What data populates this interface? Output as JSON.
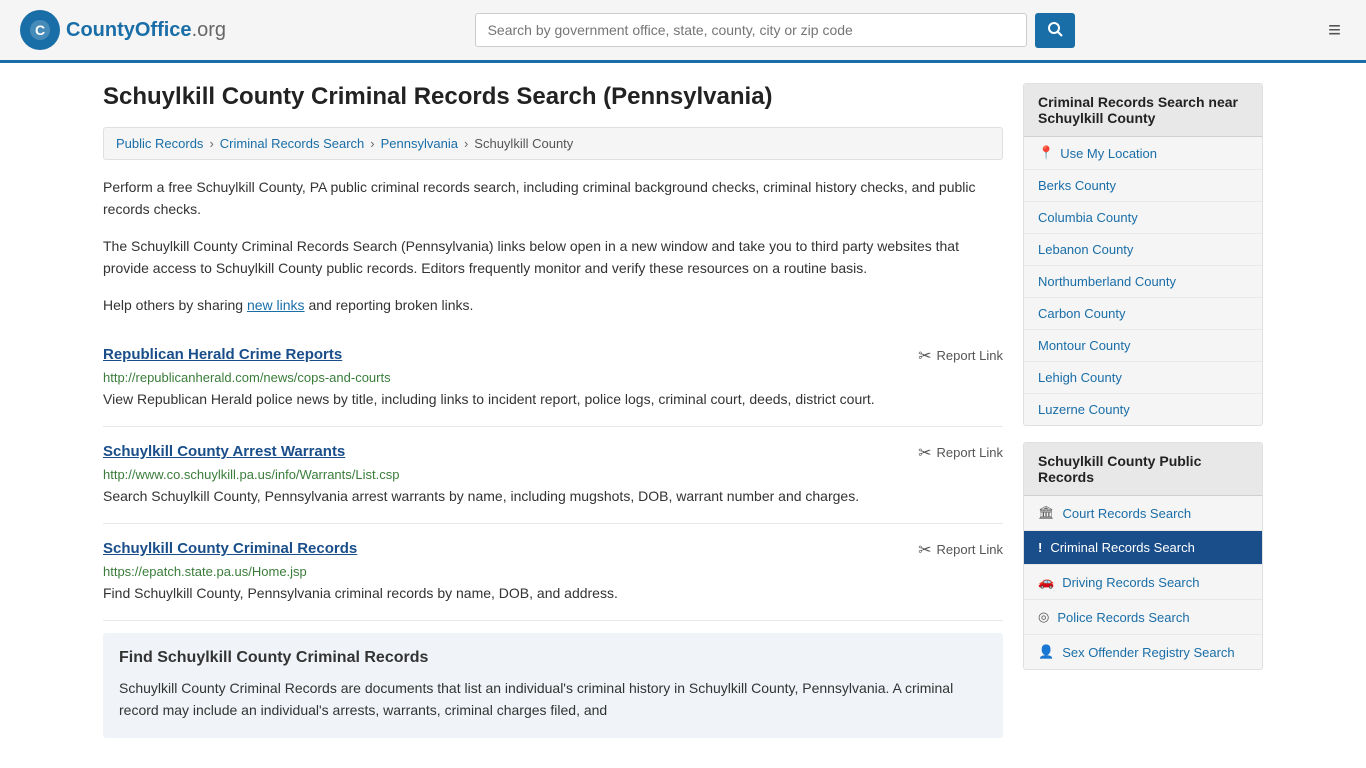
{
  "header": {
    "logo_text": "CountyOffice",
    "logo_tld": ".org",
    "search_placeholder": "Search by government office, state, county, city or zip code",
    "menu_icon": "≡"
  },
  "page": {
    "title": "Schuylkill County Criminal Records Search (Pennsylvania)",
    "breadcrumb": [
      {
        "label": "Public Records",
        "href": "#"
      },
      {
        "label": "Criminal Records Search",
        "href": "#"
      },
      {
        "label": "Pennsylvania",
        "href": "#"
      },
      {
        "label": "Schuylkill County",
        "href": "#"
      }
    ],
    "description1": "Perform a free Schuylkill County, PA public criminal records search, including criminal background checks, criminal history checks, and public records checks.",
    "description2": "The Schuylkill County Criminal Records Search (Pennsylvania) links below open in a new window and take you to third party websites that provide access to Schuylkill County public records. Editors frequently monitor and verify these resources on a routine basis.",
    "description3_prefix": "Help others by sharing ",
    "description3_link": "new links",
    "description3_suffix": " and reporting broken links.",
    "resources": [
      {
        "title": "Republican Herald Crime Reports",
        "url": "http://republicanherald.com/news/cops-and-courts",
        "desc": "View Republican Herald police news by title, including links to incident report, police logs, criminal court, deeds, district court.",
        "report_label": "Report Link"
      },
      {
        "title": "Schuylkill County Arrest Warrants",
        "url": "http://www.co.schuylkill.pa.us/info/Warrants/List.csp",
        "desc": "Search Schuylkill County, Pennsylvania arrest warrants by name, including mugshots, DOB, warrant number and charges.",
        "report_label": "Report Link"
      },
      {
        "title": "Schuylkill County Criminal Records",
        "url": "https://epatch.state.pa.us/Home.jsp",
        "desc": "Find Schuylkill County, Pennsylvania criminal records by name, DOB, and address.",
        "report_label": "Report Link"
      }
    ],
    "find_section": {
      "title": "Find Schuylkill County Criminal Records",
      "desc": "Schuylkill County Criminal Records are documents that list an individual's criminal history in Schuylkill County, Pennsylvania. A criminal record may include an individual's arrests, warrants, criminal charges filed, and"
    }
  },
  "sidebar": {
    "nearby_section": {
      "title": "Criminal Records Search near Schuylkill County",
      "use_location": "Use My Location",
      "counties": [
        "Berks County",
        "Columbia County",
        "Lebanon County",
        "Northumberland County",
        "Carbon County",
        "Montour County",
        "Lehigh County",
        "Luzerne County"
      ]
    },
    "public_records_section": {
      "title": "Schuylkill County Public Records",
      "items": [
        {
          "label": "Court Records Search",
          "icon": "🏛",
          "active": false
        },
        {
          "label": "Criminal Records Search",
          "icon": "!",
          "active": true
        },
        {
          "label": "Driving Records Search",
          "icon": "🚗",
          "active": false
        },
        {
          "label": "Police Records Search",
          "icon": "◎",
          "active": false
        },
        {
          "label": "Sex Offender Registry Search",
          "icon": "👤",
          "active": false
        }
      ]
    }
  }
}
